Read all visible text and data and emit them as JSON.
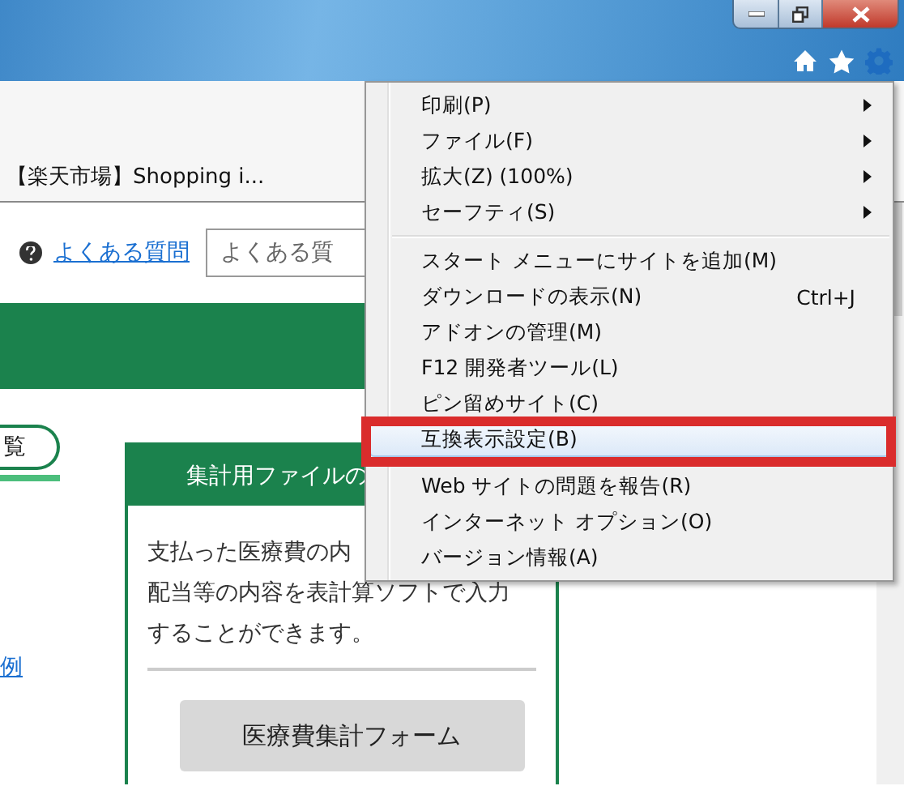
{
  "favorites_bar": {
    "items": [
      {
        "label": "【楽天市場】Shopping i..."
      }
    ]
  },
  "header": {
    "faq_link": "よくある質問",
    "search": {
      "placeholder": "よくある質"
    }
  },
  "tabs": [
    {
      "label": "覧",
      "selected": true
    }
  ],
  "side_link": "例",
  "card": {
    "title": "集計用ファイルの",
    "lines": [
      "支払った医療費の内",
      "配当等の内容を表計算ソフトで入力",
      "することができます。"
    ],
    "button": "医療費集計フォーム"
  },
  "menu": {
    "items": [
      {
        "kind": "item",
        "label": "印刷(P)",
        "submenu": true,
        "selected": false,
        "marked": false
      },
      {
        "kind": "item",
        "label": "ファイル(F)",
        "submenu": true,
        "selected": false,
        "marked": false
      },
      {
        "kind": "item",
        "label": "拡大(Z) (100%)",
        "submenu": true,
        "selected": false,
        "marked": false
      },
      {
        "kind": "item",
        "label": "セーフティ(S)",
        "submenu": true,
        "selected": false,
        "marked": false
      },
      {
        "kind": "separator"
      },
      {
        "kind": "item",
        "label": "スタート メニューにサイトを追加(M)",
        "submenu": false,
        "selected": false,
        "marked": false
      },
      {
        "kind": "item",
        "label": "ダウンロードの表示(N)",
        "shortcut": "Ctrl+J",
        "submenu": false,
        "selected": false,
        "marked": false
      },
      {
        "kind": "item",
        "label": "アドオンの管理(M)",
        "submenu": false,
        "selected": false,
        "marked": false
      },
      {
        "kind": "item",
        "label": "F12 開発者ツール(L)",
        "submenu": false,
        "selected": false,
        "marked": false
      },
      {
        "kind": "item",
        "label": "ピン留めサイト(C)",
        "submenu": false,
        "selected": false,
        "marked": false
      },
      {
        "kind": "item",
        "label": "互換表示設定(B)",
        "submenu": false,
        "selected": true,
        "marked": true
      },
      {
        "kind": "separator"
      },
      {
        "kind": "item",
        "label": "Web サイトの問題を報告(R)",
        "submenu": false,
        "selected": false,
        "marked": false
      },
      {
        "kind": "item",
        "label": "インターネット オプション(O)",
        "submenu": false,
        "selected": false,
        "marked": false
      },
      {
        "kind": "item",
        "label": "バージョン情報(A)",
        "submenu": false,
        "selected": false,
        "marked": false
      }
    ]
  }
}
